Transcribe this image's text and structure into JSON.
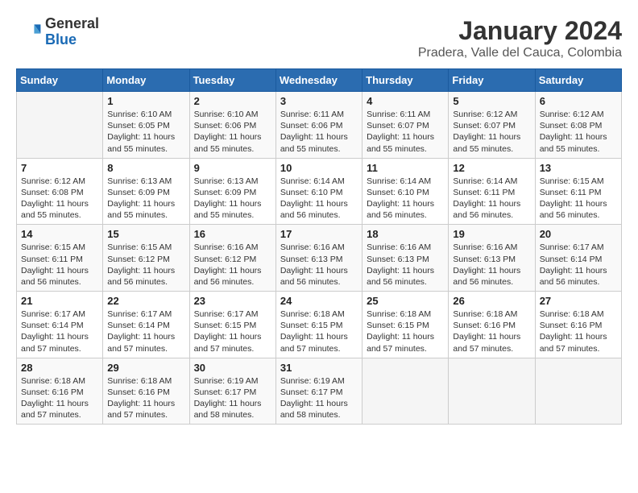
{
  "header": {
    "logo_general": "General",
    "logo_blue": "Blue",
    "title": "January 2024",
    "subtitle": "Pradera, Valle del Cauca, Colombia"
  },
  "days_of_week": [
    "Sunday",
    "Monday",
    "Tuesday",
    "Wednesday",
    "Thursday",
    "Friday",
    "Saturday"
  ],
  "weeks": [
    [
      {
        "day": "",
        "info": ""
      },
      {
        "day": "1",
        "info": "Sunrise: 6:10 AM\nSunset: 6:05 PM\nDaylight: 11 hours\nand 55 minutes."
      },
      {
        "day": "2",
        "info": "Sunrise: 6:10 AM\nSunset: 6:06 PM\nDaylight: 11 hours\nand 55 minutes."
      },
      {
        "day": "3",
        "info": "Sunrise: 6:11 AM\nSunset: 6:06 PM\nDaylight: 11 hours\nand 55 minutes."
      },
      {
        "day": "4",
        "info": "Sunrise: 6:11 AM\nSunset: 6:07 PM\nDaylight: 11 hours\nand 55 minutes."
      },
      {
        "day": "5",
        "info": "Sunrise: 6:12 AM\nSunset: 6:07 PM\nDaylight: 11 hours\nand 55 minutes."
      },
      {
        "day": "6",
        "info": "Sunrise: 6:12 AM\nSunset: 6:08 PM\nDaylight: 11 hours\nand 55 minutes."
      }
    ],
    [
      {
        "day": "7",
        "info": "Sunrise: 6:12 AM\nSunset: 6:08 PM\nDaylight: 11 hours\nand 55 minutes."
      },
      {
        "day": "8",
        "info": "Sunrise: 6:13 AM\nSunset: 6:09 PM\nDaylight: 11 hours\nand 55 minutes."
      },
      {
        "day": "9",
        "info": "Sunrise: 6:13 AM\nSunset: 6:09 PM\nDaylight: 11 hours\nand 55 minutes."
      },
      {
        "day": "10",
        "info": "Sunrise: 6:14 AM\nSunset: 6:10 PM\nDaylight: 11 hours\nand 56 minutes."
      },
      {
        "day": "11",
        "info": "Sunrise: 6:14 AM\nSunset: 6:10 PM\nDaylight: 11 hours\nand 56 minutes."
      },
      {
        "day": "12",
        "info": "Sunrise: 6:14 AM\nSunset: 6:11 PM\nDaylight: 11 hours\nand 56 minutes."
      },
      {
        "day": "13",
        "info": "Sunrise: 6:15 AM\nSunset: 6:11 PM\nDaylight: 11 hours\nand 56 minutes."
      }
    ],
    [
      {
        "day": "14",
        "info": "Sunrise: 6:15 AM\nSunset: 6:11 PM\nDaylight: 11 hours\nand 56 minutes."
      },
      {
        "day": "15",
        "info": "Sunrise: 6:15 AM\nSunset: 6:12 PM\nDaylight: 11 hours\nand 56 minutes."
      },
      {
        "day": "16",
        "info": "Sunrise: 6:16 AM\nSunset: 6:12 PM\nDaylight: 11 hours\nand 56 minutes."
      },
      {
        "day": "17",
        "info": "Sunrise: 6:16 AM\nSunset: 6:13 PM\nDaylight: 11 hours\nand 56 minutes."
      },
      {
        "day": "18",
        "info": "Sunrise: 6:16 AM\nSunset: 6:13 PM\nDaylight: 11 hours\nand 56 minutes."
      },
      {
        "day": "19",
        "info": "Sunrise: 6:16 AM\nSunset: 6:13 PM\nDaylight: 11 hours\nand 56 minutes."
      },
      {
        "day": "20",
        "info": "Sunrise: 6:17 AM\nSunset: 6:14 PM\nDaylight: 11 hours\nand 56 minutes."
      }
    ],
    [
      {
        "day": "21",
        "info": "Sunrise: 6:17 AM\nSunset: 6:14 PM\nDaylight: 11 hours\nand 57 minutes."
      },
      {
        "day": "22",
        "info": "Sunrise: 6:17 AM\nSunset: 6:14 PM\nDaylight: 11 hours\nand 57 minutes."
      },
      {
        "day": "23",
        "info": "Sunrise: 6:17 AM\nSunset: 6:15 PM\nDaylight: 11 hours\nand 57 minutes."
      },
      {
        "day": "24",
        "info": "Sunrise: 6:18 AM\nSunset: 6:15 PM\nDaylight: 11 hours\nand 57 minutes."
      },
      {
        "day": "25",
        "info": "Sunrise: 6:18 AM\nSunset: 6:15 PM\nDaylight: 11 hours\nand 57 minutes."
      },
      {
        "day": "26",
        "info": "Sunrise: 6:18 AM\nSunset: 6:16 PM\nDaylight: 11 hours\nand 57 minutes."
      },
      {
        "day": "27",
        "info": "Sunrise: 6:18 AM\nSunset: 6:16 PM\nDaylight: 11 hours\nand 57 minutes."
      }
    ],
    [
      {
        "day": "28",
        "info": "Sunrise: 6:18 AM\nSunset: 6:16 PM\nDaylight: 11 hours\nand 57 minutes."
      },
      {
        "day": "29",
        "info": "Sunrise: 6:18 AM\nSunset: 6:16 PM\nDaylight: 11 hours\nand 57 minutes."
      },
      {
        "day": "30",
        "info": "Sunrise: 6:19 AM\nSunset: 6:17 PM\nDaylight: 11 hours\nand 58 minutes."
      },
      {
        "day": "31",
        "info": "Sunrise: 6:19 AM\nSunset: 6:17 PM\nDaylight: 11 hours\nand 58 minutes."
      },
      {
        "day": "",
        "info": ""
      },
      {
        "day": "",
        "info": ""
      },
      {
        "day": "",
        "info": ""
      }
    ]
  ]
}
